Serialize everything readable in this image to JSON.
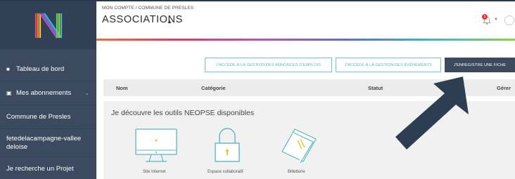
{
  "sidebar": {
    "logo": "N",
    "items": [
      {
        "label": "Tableau de bord",
        "icon": "dashboard-icon"
      },
      {
        "label": "Mes abonnements",
        "icon": "subscriptions-icon"
      },
      {
        "label": "Commune de Presles"
      },
      {
        "label": "fetedelacampagne-valleedeloise"
      },
      {
        "label": "Je recherche un Projet"
      }
    ]
  },
  "header": {
    "breadcrumb": "MON COMPTE / COMMUNE DE PRESLES",
    "title": "ASSOCIATIONS",
    "notification_count": "1"
  },
  "toolbar": {
    "btn_annonces": "J'ACCÈDE À LA GESTION DES ANNONCES D'EMPLOIS",
    "btn_evenements": "J'ACCÈDE À LA GESTION DES ÉVÉNEMENTS",
    "btn_fiche": "J'ENREGISTRE UNE FICHE"
  },
  "table": {
    "columns": [
      "Nom",
      "Catégorie",
      "Statut",
      "Gérer"
    ]
  },
  "discover": {
    "title": "Je découvre les outils NEOPSE disponibles",
    "tools": [
      {
        "label": "Site Internet",
        "icon": "monitor-icon"
      },
      {
        "label": "Espace collaboratif",
        "icon": "padlock-icon"
      },
      {
        "label": "Billetterie",
        "icon": "tickets-icon"
      }
    ]
  },
  "colors": {
    "sidebar": "#3b4a5e",
    "accent": "#5bb8bf",
    "dark_button": "#3c4a5d",
    "arrow": "#2d3e53"
  }
}
